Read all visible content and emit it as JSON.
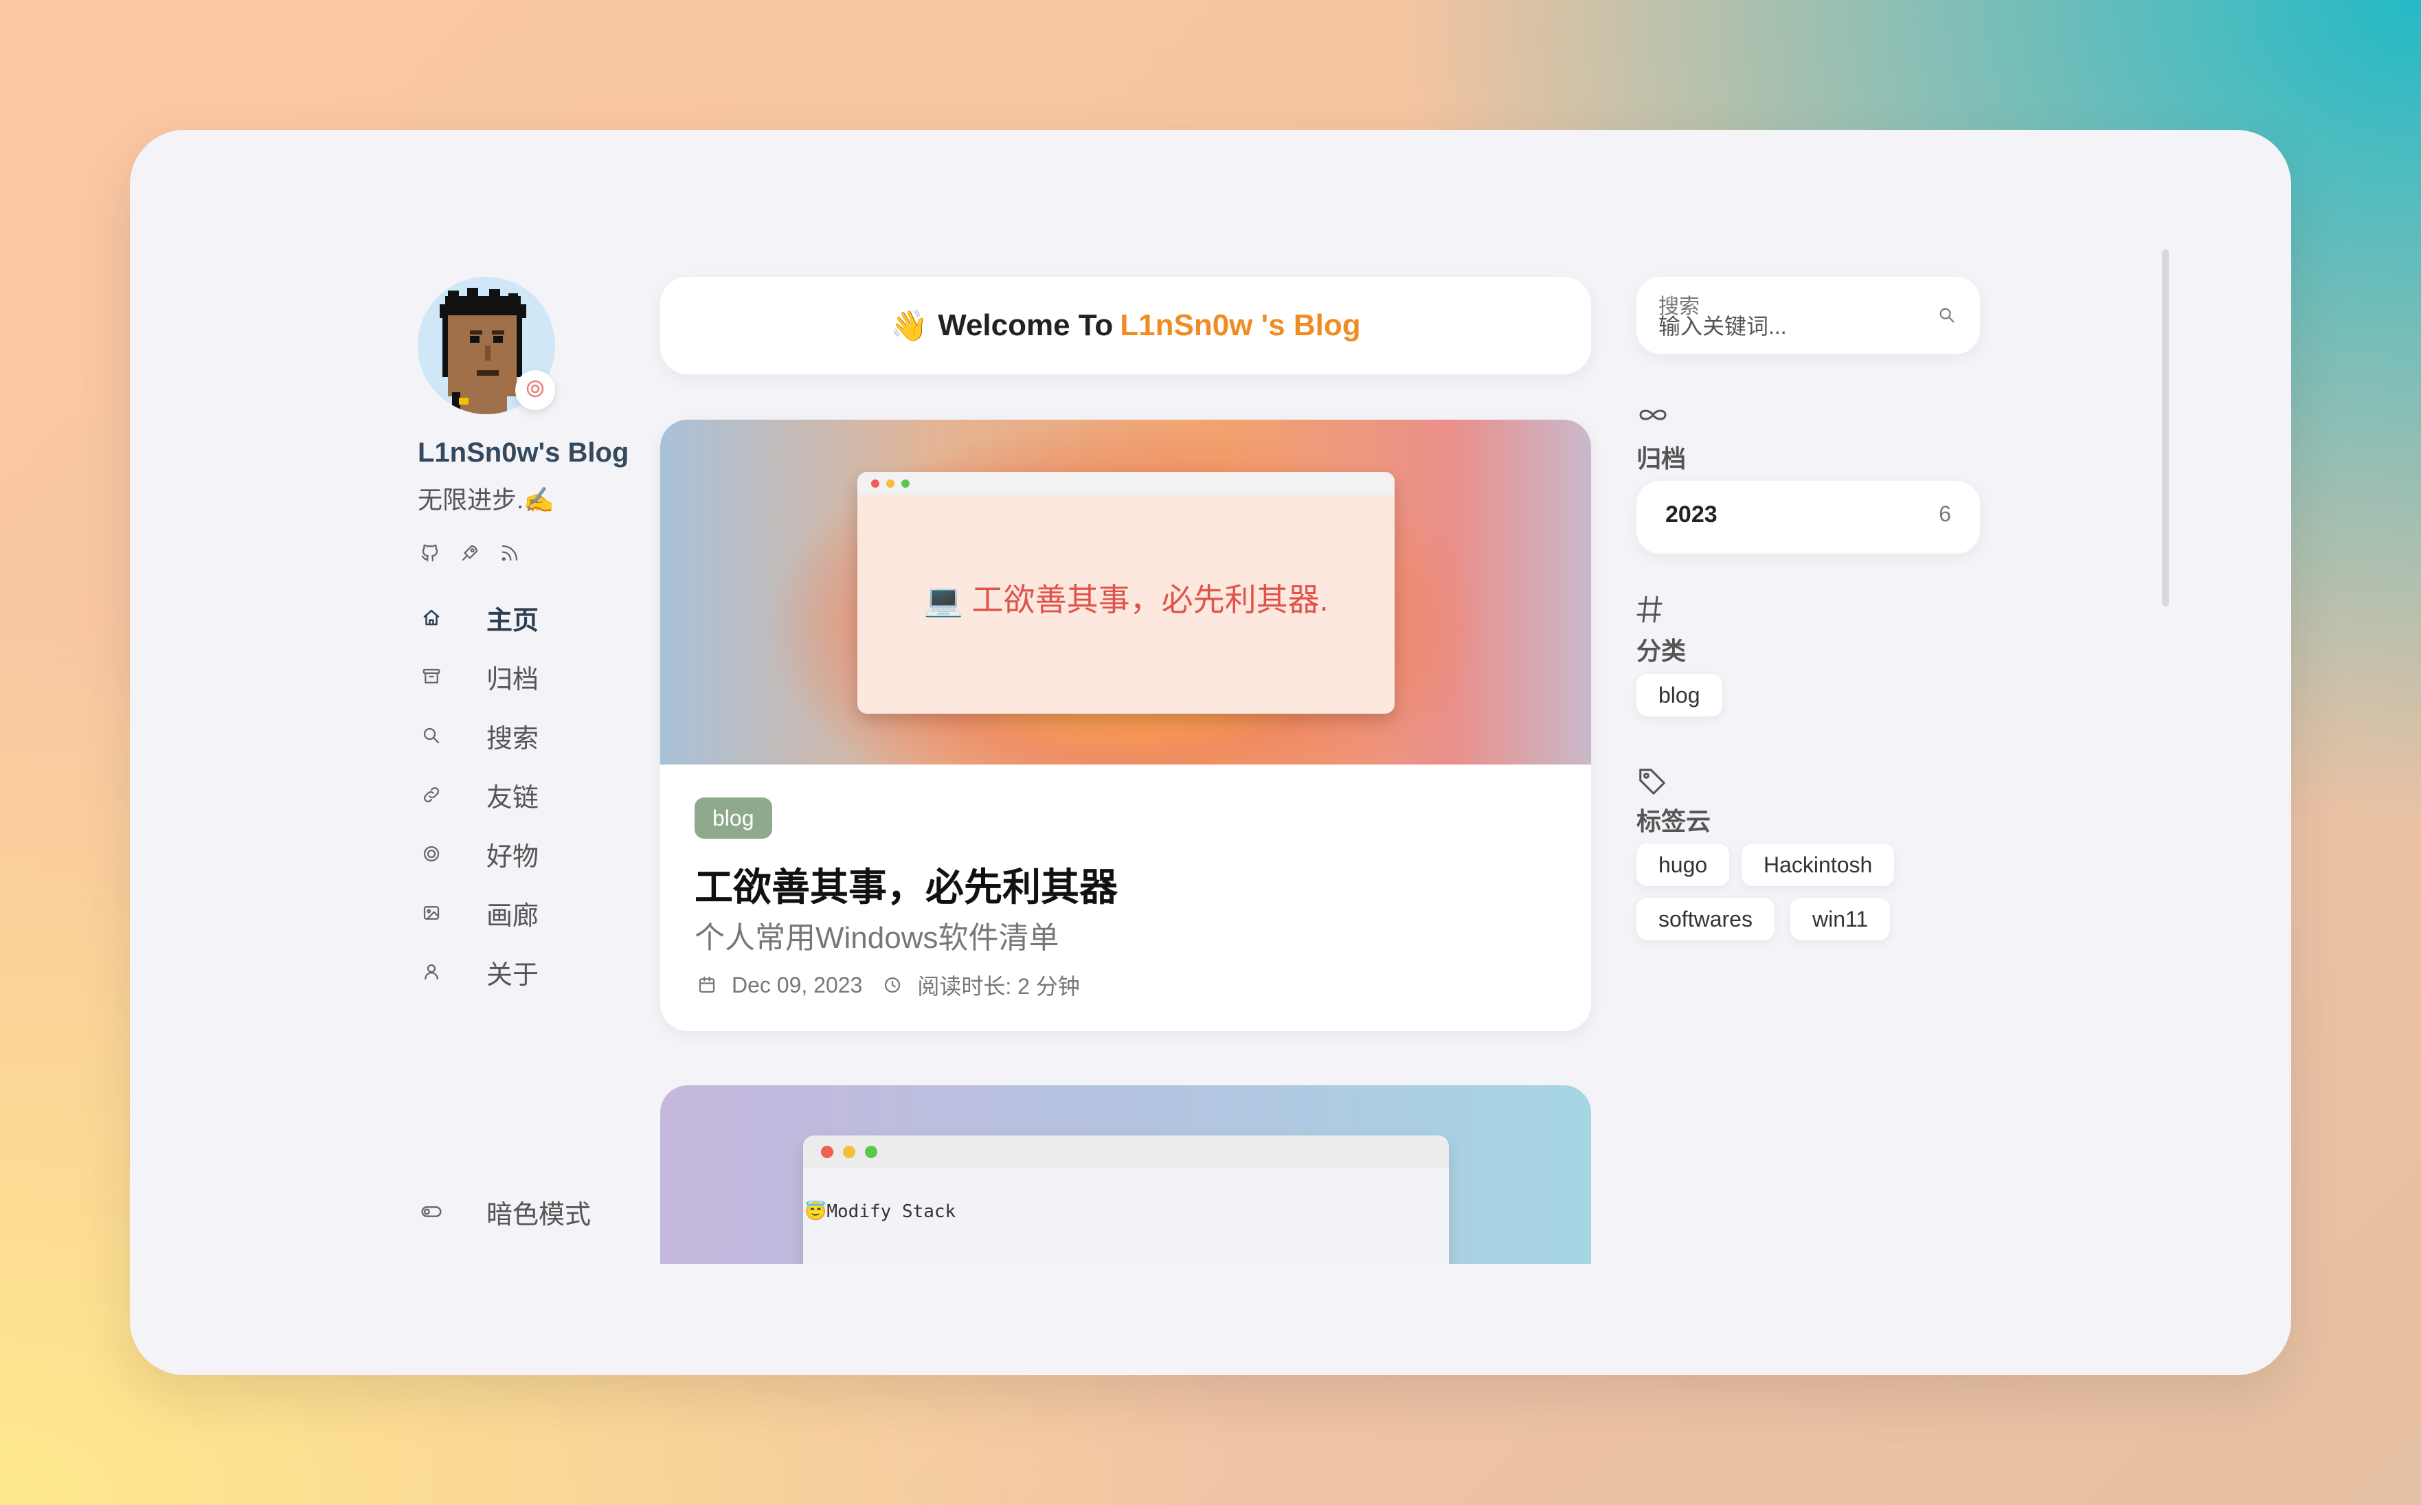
{
  "site": {
    "title": "L1nSn0w's Blog",
    "subtitle": "无限进步.✍️",
    "social_icons": [
      "github-icon",
      "rocket-icon",
      "rss-icon"
    ]
  },
  "nav": {
    "items": [
      {
        "label": "主页",
        "icon": "home-icon",
        "active": true
      },
      {
        "label": "归档",
        "icon": "archive-icon",
        "active": false
      },
      {
        "label": "搜索",
        "icon": "search-icon",
        "active": false
      },
      {
        "label": "友链",
        "icon": "link-icon",
        "active": false
      },
      {
        "label": "好物",
        "icon": "target-icon",
        "active": false
      },
      {
        "label": "画廊",
        "icon": "image-icon",
        "active": false
      },
      {
        "label": "关于",
        "icon": "user-icon",
        "active": false
      }
    ],
    "dark_mode_label": "暗色模式"
  },
  "welcome": {
    "emoji": "👋",
    "prefix": "Welcome To",
    "name": "L1nSn0w 's Blog"
  },
  "posts": [
    {
      "cover_text": "💻 工欲善其事，必先利其器.",
      "category": "blog",
      "title": "工欲善其事，必先利其器",
      "description": "个人常用Windows软件清单",
      "date": "Dec 09, 2023",
      "read_time": "阅读时长: 2 分钟"
    },
    {
      "cover_code": "😇Modify Stack"
    }
  ],
  "search": {
    "label": "搜索",
    "placeholder": "输入关键词..."
  },
  "archives": {
    "icon": "infinity-icon",
    "title": "归档",
    "items": [
      {
        "year": "2023",
        "count": "6"
      }
    ]
  },
  "categories": {
    "icon": "hash-icon",
    "title": "分类",
    "items": [
      "blog"
    ]
  },
  "tags": {
    "icon": "tag-icon",
    "title": "标签云",
    "items": [
      "hugo",
      "Hackintosh",
      "softwares",
      "win11"
    ]
  },
  "colors": {
    "accent": "#f08c24",
    "category_badge": "#8fa98c",
    "cover_text": "#e0534a"
  }
}
